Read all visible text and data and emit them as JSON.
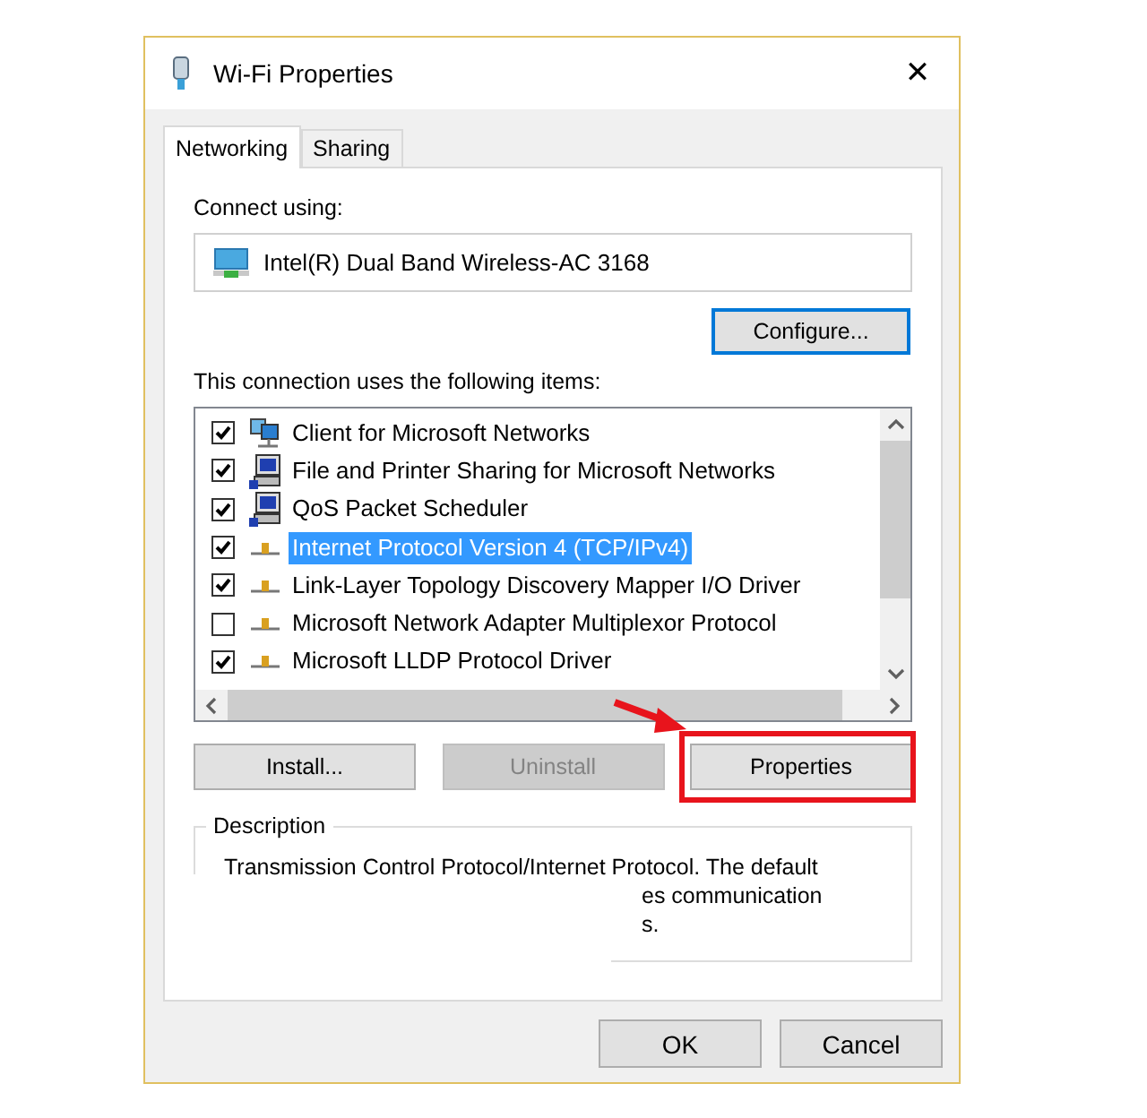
{
  "window": {
    "title": "Wi-Fi Properties",
    "close": "✕"
  },
  "tabs": [
    {
      "label": "Networking",
      "selected": true
    },
    {
      "label": "Sharing",
      "selected": false
    }
  ],
  "connect_using": {
    "label": "Connect using:",
    "adapter": "Intel(R) Dual Band Wireless-AC 3168",
    "configure_button": "Configure..."
  },
  "items_label": "This connection uses the following items:",
  "items": [
    {
      "label": "Client for Microsoft Networks",
      "checked": true,
      "selected": false,
      "kind": "client"
    },
    {
      "label": "File and Printer Sharing for Microsoft Networks",
      "checked": true,
      "selected": false,
      "kind": "service"
    },
    {
      "label": "QoS Packet Scheduler",
      "checked": true,
      "selected": false,
      "kind": "service"
    },
    {
      "label": "Internet Protocol Version 4 (TCP/IPv4)",
      "checked": true,
      "selected": true,
      "kind": "protocol"
    },
    {
      "label": "Link-Layer Topology Discovery Mapper I/O Driver",
      "checked": true,
      "selected": false,
      "kind": "protocol"
    },
    {
      "label": "Microsoft Network Adapter Multiplexor Protocol",
      "checked": false,
      "selected": false,
      "kind": "protocol"
    },
    {
      "label": "Microsoft LLDP Protocol Driver",
      "checked": true,
      "selected": false,
      "kind": "protocol"
    }
  ],
  "action_buttons": [
    {
      "label": "Install...",
      "disabled": false,
      "highlighted": false
    },
    {
      "label": "Uninstall",
      "disabled": true,
      "highlighted": false
    },
    {
      "label": "Properties",
      "disabled": false,
      "highlighted": true
    }
  ],
  "description": {
    "title": "Description",
    "lines": [
      "Transmission Control Protocol/Internet Protocol. The default",
      "es communication",
      "s."
    ]
  },
  "dialog_buttons": [
    "OK",
    "Cancel"
  ]
}
